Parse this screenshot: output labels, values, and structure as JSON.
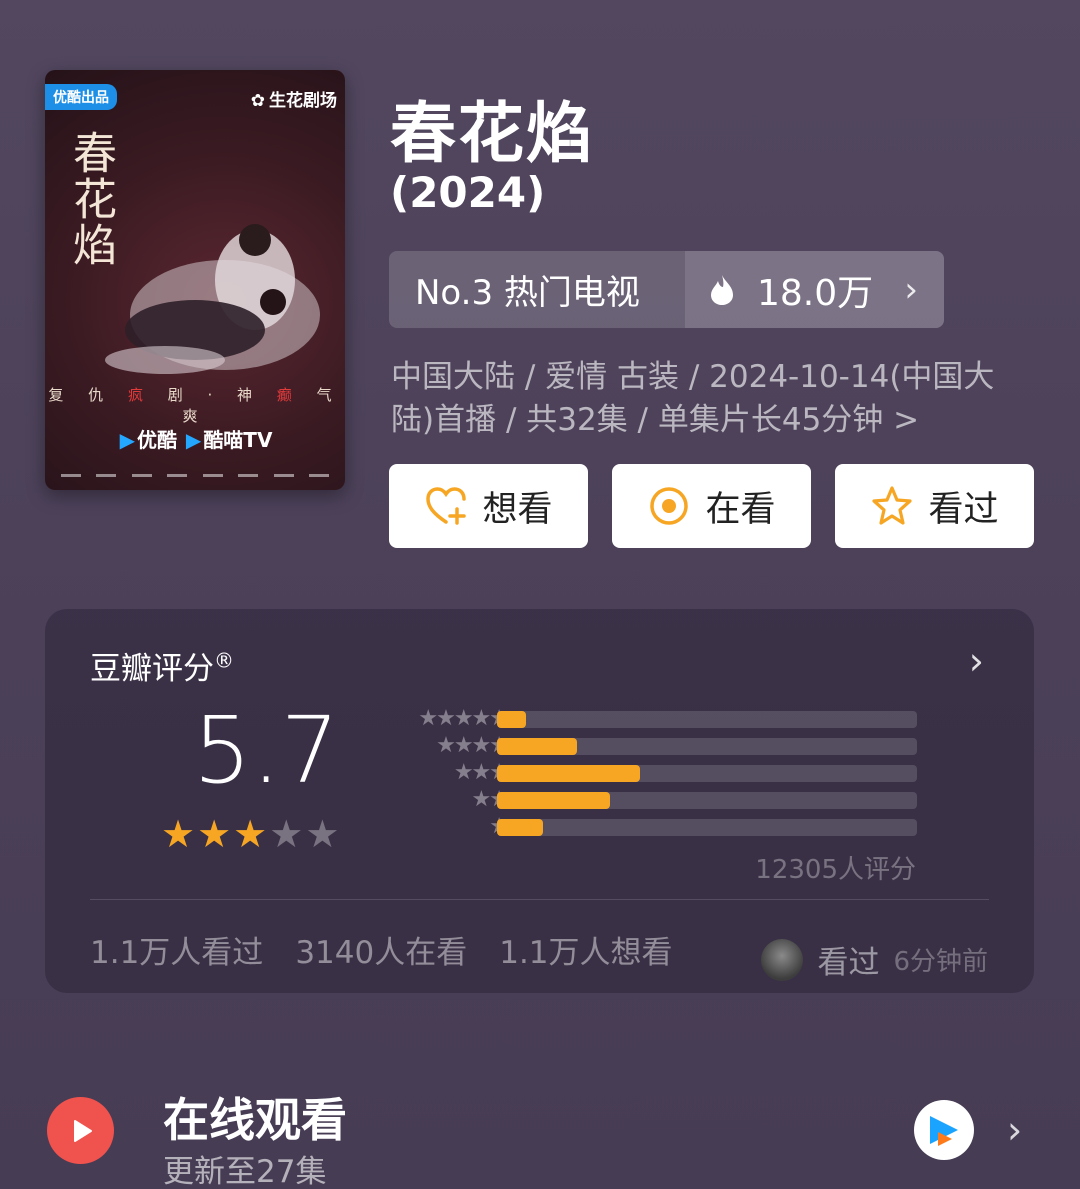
{
  "poster": {
    "badge": "优酷出品",
    "studio": "生花剧场",
    "title_text": "春花焰",
    "tagline_parts": [
      "复 仇 ",
      "疯",
      " 剧 · 神 ",
      "癫",
      " 气 爽"
    ],
    "platform_a": "优酷",
    "platform_b": "酷喵TV"
  },
  "header": {
    "title": "春花焰",
    "year": "(2024)",
    "rank_label": "No.3 热门电视",
    "heat_value": "18.0万",
    "meta": "中国大陆 / 爱情 古装 / 2024-10-14(中国大陆)首播 / 共32集 / 单集片长45分钟 >"
  },
  "actions": [
    {
      "label": "想看",
      "icon": "heart-plus-icon"
    },
    {
      "label": "在看",
      "icon": "target-circle-icon"
    },
    {
      "label": "看过",
      "icon": "star-outline-icon"
    }
  ],
  "rating": {
    "label": "豆瓣评分",
    "score": "5.7",
    "stars_filled": 3,
    "stars_total": 5,
    "distribution": [
      {
        "stars": 5,
        "fraction": 0.07
      },
      {
        "stars": 4,
        "fraction": 0.19
      },
      {
        "stars": 3,
        "fraction": 0.34
      },
      {
        "stars": 2,
        "fraction": 0.27
      },
      {
        "stars": 1,
        "fraction": 0.11
      }
    ],
    "count_text": "12305人评分",
    "stats": [
      "1.1万人看过",
      "3140人在看",
      "1.1万人想看"
    ],
    "recent_action": "看过",
    "recent_time": "6分钟前"
  },
  "online": {
    "title": "在线观看",
    "subtitle": "更新至27集"
  },
  "colors": {
    "accent": "#f6a623",
    "background": "#4c4159",
    "play": "#f0524e"
  }
}
